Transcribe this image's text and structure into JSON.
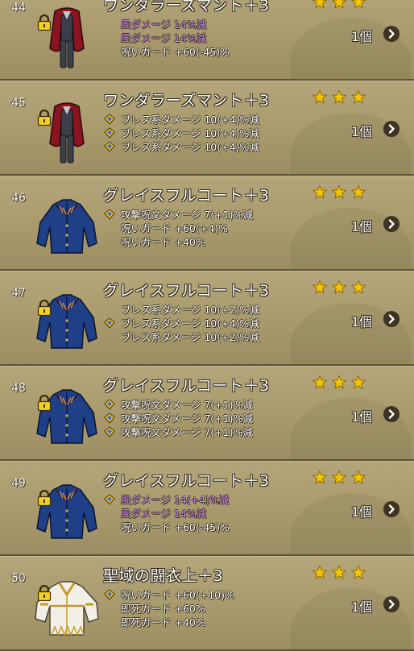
{
  "items": [
    {
      "number": "44",
      "name": "ワンダラーズマント＋3",
      "icon": "cloak-icon",
      "locked": true,
      "stars": 3,
      "stats": [
        {
          "text": "風ダメージ 14%減",
          "color": "purple",
          "gem": false
        },
        {
          "text": "風ダメージ 14%減",
          "color": "purple",
          "gem": false
        },
        {
          "text": "呪いガード +60(-45)%",
          "color": "white",
          "gem": false
        }
      ],
      "quantity": "1個"
    },
    {
      "number": "45",
      "name": "ワンダラーズマント＋3",
      "icon": "cloak-icon",
      "locked": true,
      "stars": 3,
      "stats": [
        {
          "text": "ブレス系ダメージ 10(+4)%減",
          "color": "white",
          "gem": true
        },
        {
          "text": "ブレス系ダメージ 10(+4)%減",
          "color": "white",
          "gem": true
        },
        {
          "text": "ブレス系ダメージ 10(+4)%減",
          "color": "white",
          "gem": true
        }
      ],
      "quantity": "1個"
    },
    {
      "number": "46",
      "name": "グレイスフルコート＋3",
      "icon": "coat-icon",
      "locked": false,
      "stars": 3,
      "stats": [
        {
          "text": "攻撃呪文ダメージ 7(+1)%減",
          "color": "white",
          "gem": true
        },
        {
          "text": "呪いガード +60(+4)%",
          "color": "white",
          "gem": false
        },
        {
          "text": "呪いガード +40%",
          "color": "white",
          "gem": false
        }
      ],
      "quantity": "1個"
    },
    {
      "number": "47",
      "name": "グレイスフルコート＋3",
      "icon": "coat-icon",
      "locked": true,
      "stars": 3,
      "stats": [
        {
          "text": "ブレス系ダメージ 10(+2)%減",
          "color": "white",
          "gem": false
        },
        {
          "text": "ブレス系ダメージ 10(+4)%減",
          "color": "white",
          "gem": true
        },
        {
          "text": "ブレス系ダメージ 10(+2)%減",
          "color": "white",
          "gem": false
        }
      ],
      "quantity": "1個"
    },
    {
      "number": "48",
      "name": "グレイスフルコート＋3",
      "icon": "coat-icon",
      "locked": true,
      "stars": 3,
      "stats": [
        {
          "text": "攻撃呪文ダメージ 7(+1)%減",
          "color": "white",
          "gem": true
        },
        {
          "text": "攻撃呪文ダメージ 7(+1)%減",
          "color": "white",
          "gem": true
        },
        {
          "text": "攻撃呪文ダメージ 7(+1)%減",
          "color": "white",
          "gem": true
        }
      ],
      "quantity": "1個"
    },
    {
      "number": "49",
      "name": "グレイスフルコート＋3",
      "icon": "coat-icon",
      "locked": true,
      "stars": 3,
      "stats": [
        {
          "text": "風ダメージ 14(+4)%減",
          "color": "purple",
          "gem": true
        },
        {
          "text": "風ダメージ 14%減",
          "color": "purple",
          "gem": false
        },
        {
          "text": "呪いガード +60(-45)%",
          "color": "white",
          "gem": false
        }
      ],
      "quantity": "1個"
    },
    {
      "number": "50",
      "name": "聖域の闘衣上＋3",
      "icon": "tunic-icon",
      "locked": true,
      "stars": 3,
      "stats": [
        {
          "text": "呪いガード +60(+10)%",
          "color": "white",
          "gem": true
        },
        {
          "text": "即死ガード +60%",
          "color": "white",
          "gem": false
        },
        {
          "text": "即死ガード +40%",
          "color": "white",
          "gem": false
        }
      ],
      "quantity": "1個"
    }
  ],
  "colors": {
    "star": "#f5c400",
    "purple_stat": "#d58cf5",
    "row_bg": "#a89a6c",
    "coat_blue": "#1f3f86",
    "cloak_red": "#8c1420"
  }
}
